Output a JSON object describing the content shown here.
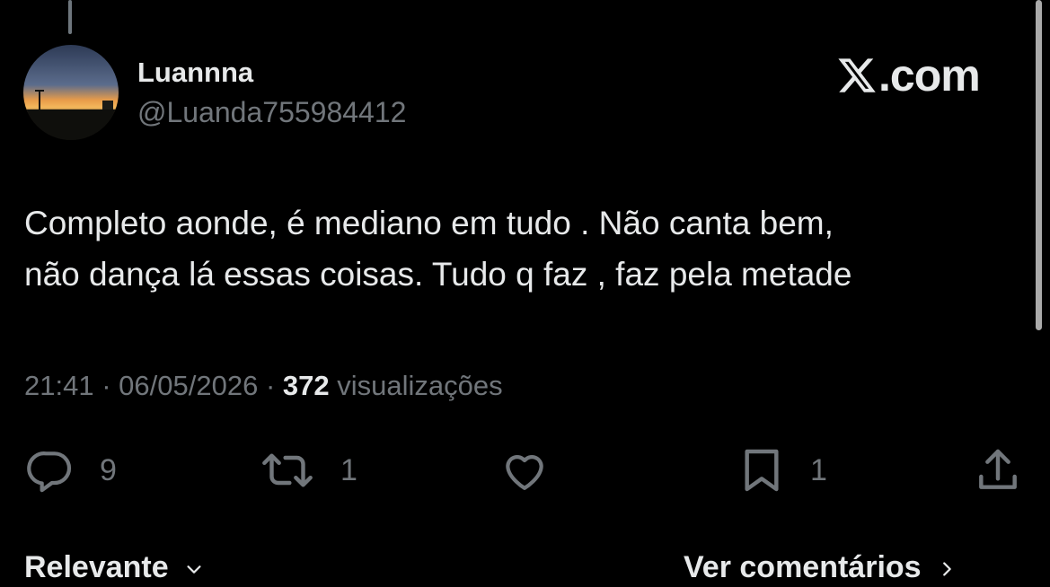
{
  "author": {
    "display_name": "Luannna",
    "handle": "@Luanda755984412"
  },
  "brand": {
    "logo_icon": "x-logo-icon",
    "text": ".com"
  },
  "tweet": {
    "lines": [
      "Completo aonde, é mediano em tudo . Não canta bem,",
      "não dança lá essas coisas. Tudo q faz , faz pela metade"
    ]
  },
  "meta": {
    "time": "21:41",
    "separator": "·",
    "date": "06/05/2026",
    "views_count": "372",
    "views_label": "visualizações"
  },
  "actions": {
    "reply": {
      "icon": "reply-icon",
      "count": "9"
    },
    "retweet": {
      "icon": "retweet-icon",
      "count": "1"
    },
    "like": {
      "icon": "heart-icon",
      "count": ""
    },
    "bookmark": {
      "icon": "bookmark-icon",
      "count": "1"
    },
    "share": {
      "icon": "share-icon"
    }
  },
  "footer": {
    "sort_label": "Relevante",
    "comments_label": "Ver comentários"
  },
  "colors": {
    "background": "#000000",
    "primary_text": "#e7e9ea",
    "secondary_text": "#71767b"
  }
}
